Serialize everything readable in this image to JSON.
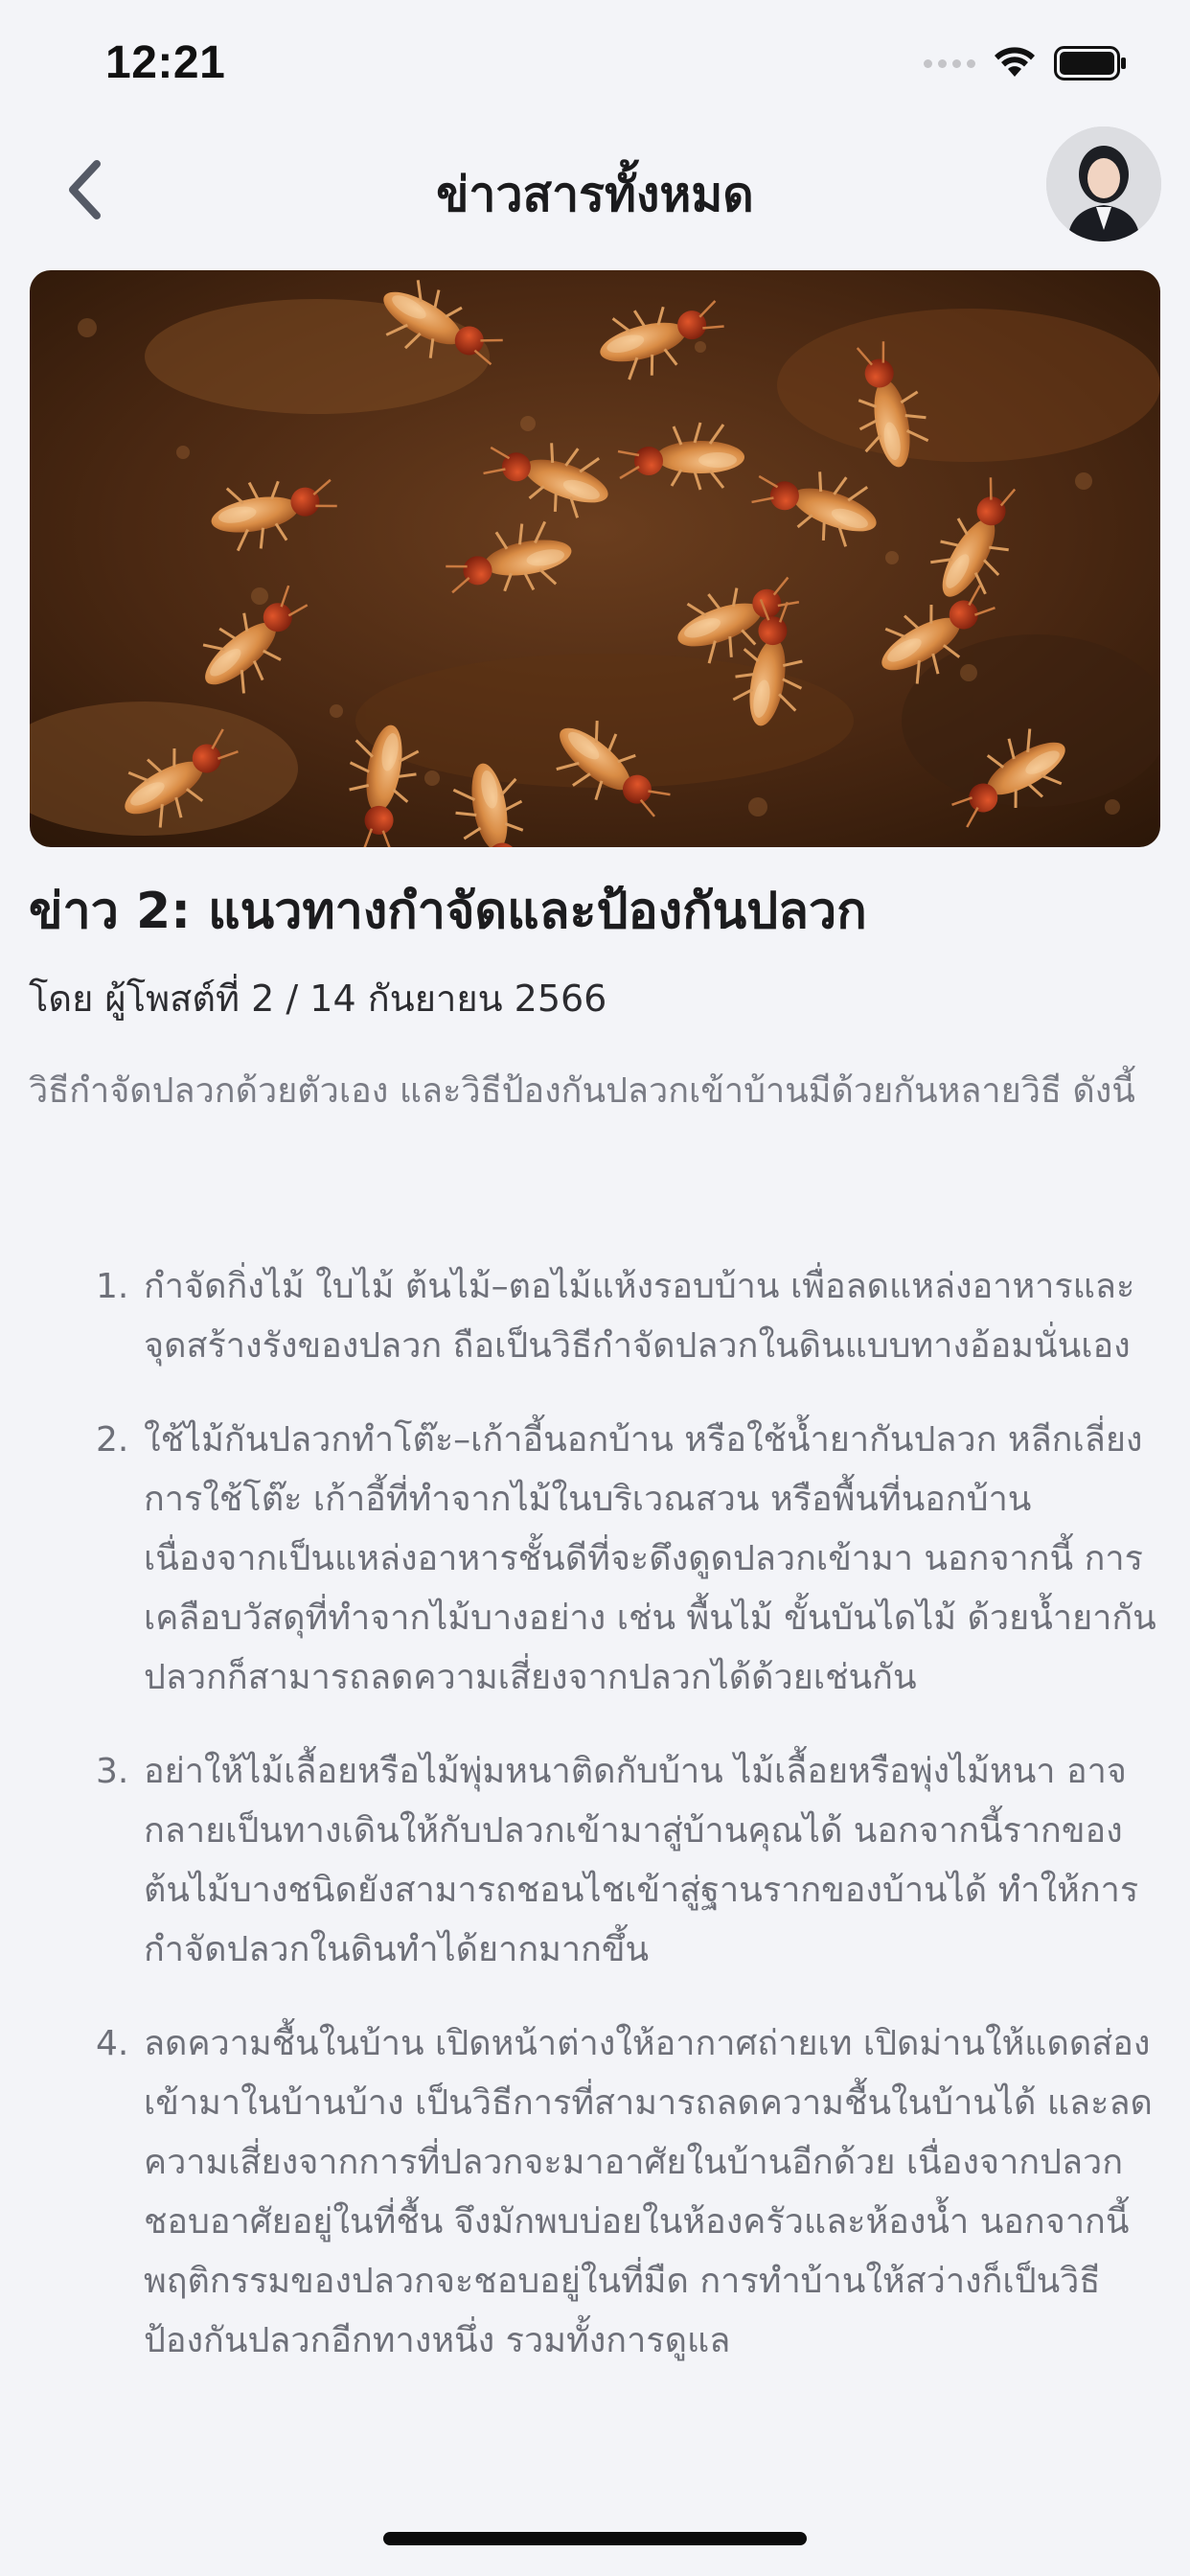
{
  "status_bar": {
    "time": "12:21"
  },
  "nav": {
    "title": "ข่าวสารทั้งหมด"
  },
  "article": {
    "title": "ข่าว 2: แนวทางกำจัดและป้องกันปลวก",
    "byline": "โดย ผู้โพสต์ที่ 2 / 14 กันยายน 2566",
    "intro": "วิธีกำจัดปลวกด้วยตัวเอง และวิธีป้องกันปลวกเข้าบ้านมีด้วยกันหลายวิธี ดังนี้",
    "items": [
      {
        "num": "1.",
        "text": "กำจัดกิ่งไม้ ใบไม้ ต้นไม้–ตอไม้แห้งรอบบ้าน เพื่อลดแหล่งอาหารและจุดสร้างรังของปลวก ถือเป็นวิธีกำจัดปลวกในดินแบบทางอ้อมนั่นเอง"
      },
      {
        "num": "2.",
        "text": "ใช้ไม้กันปลวกทำโต๊ะ–เก้าอี้นอกบ้าน หรือใช้น้ำยากันปลวก หลีกเลี่ยงการใช้โต๊ะ เก้าอี้ที่ทำจากไม้ในบริเวณสวน หรือพื้นที่นอกบ้าน เนื่องจากเป็นแหล่งอาหารชั้นดีที่จะดึงดูดปลวกเข้ามา นอกจากนี้ การเคลือบวัสดุที่ทำจากไม้บางอย่าง เช่น พื้นไม้ ขั้นบันไดไม้ ด้วยน้ำยากันปลวกก็สามารถลดความเสี่ยงจากปลวกได้ด้วยเช่นกัน"
      },
      {
        "num": "3.",
        "text": "อย่าให้ไม้เลื้อยหรือไม้พุ่มหนาติดกับบ้าน ไม้เลื้อยหรือพุ่งไม้หนา อาจกลายเป็นทางเดินให้กับปลวกเข้ามาสู่บ้านคุณได้ นอกจากนี้รากของต้นไม้บางชนิดยังสามารถชอนไชเข้าสู่ฐานรากของบ้านได้ ทำให้การกำจัดปลวกในดินทำได้ยากมากขึ้น"
      },
      {
        "num": "4.",
        "text": "ลดความชื้นในบ้าน เปิดหน้าต่างให้อากาศถ่ายเท เปิดม่านให้แดดส่องเข้ามาในบ้านบ้าง เป็นวิธีการที่สามารถลดความชื้นในบ้านได้ และลดความเสี่ยงจากการที่ปลวกจะมาอาศัยในบ้านอีกด้วย เนื่องจากปลวกชอบอาศัยอยู่ในที่ชื้น จึงมักพบบ่อยในห้องครัวและห้องน้ำ นอกจากนี้พฤติกรรมของปลวกจะชอบอยู่ในที่มืด การทำบ้านให้สว่างก็เป็นวิธีป้องกันปลวกอีกทางหนึ่ง รวมทั้งการดูแล"
      }
    ]
  }
}
